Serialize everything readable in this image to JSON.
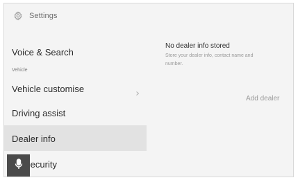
{
  "header": {
    "title": "Settings",
    "icon": "gear-icon"
  },
  "sidebar": {
    "items": [
      {
        "label": "Voice & Search",
        "sub": "Vehicle"
      },
      {
        "label": "Vehicle customise",
        "icon": "chevron-right-icon"
      },
      {
        "label": "Driving assist"
      },
      {
        "label": "Dealer info",
        "selected": true
      },
      {
        "label": "Security"
      }
    ]
  },
  "content": {
    "heading": "No dealer info stored",
    "description": "Store your dealer info, contact name and number.",
    "add_button": "Add dealer"
  },
  "mic": {
    "icon": "microphone-icon"
  },
  "colors": {
    "background": "#f4f4f4",
    "selected_row": "#e2e2e2",
    "mic_button": "#4a4a4a"
  }
}
